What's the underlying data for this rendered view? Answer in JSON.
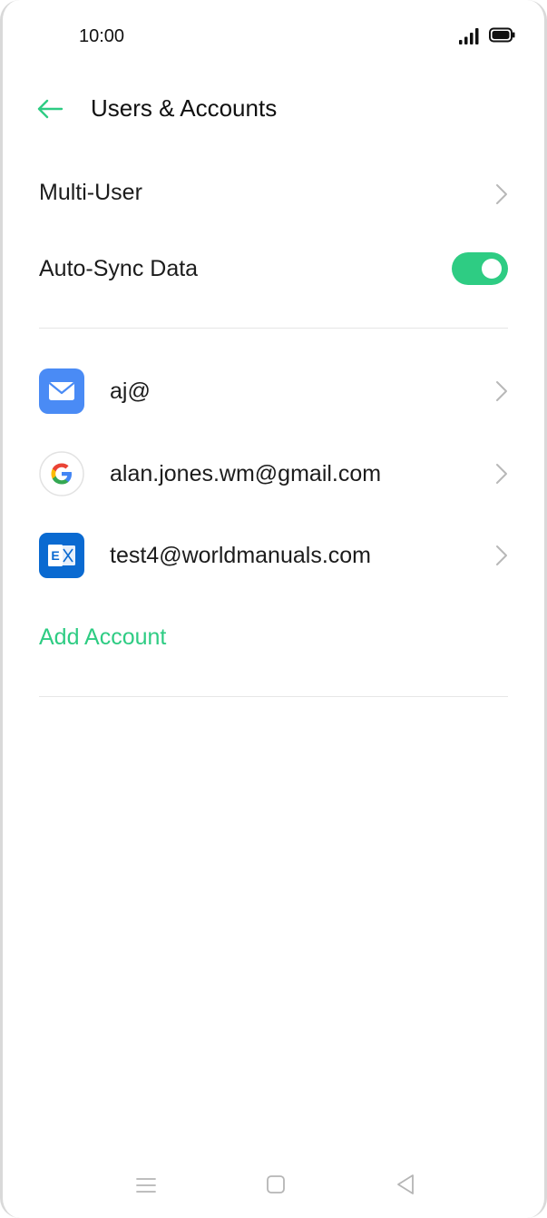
{
  "status_bar": {
    "time": "10:00"
  },
  "header": {
    "title": "Users & Accounts"
  },
  "settings": {
    "multi_user_label": "Multi-User",
    "auto_sync_label": "Auto-Sync Data",
    "auto_sync_on": true
  },
  "accounts": [
    {
      "label": "aj@",
      "icon": "email-icon"
    },
    {
      "label": "alan.jones.wm@gmail.com",
      "icon": "google-icon"
    },
    {
      "label": "test4@worldmanuals.com",
      "icon": "exchange-icon"
    }
  ],
  "add_account_label": "Add Account",
  "colors": {
    "accent": "#2ecc83",
    "email_blue": "#4a8bf5",
    "exchange_blue": "#0a6ad1"
  }
}
